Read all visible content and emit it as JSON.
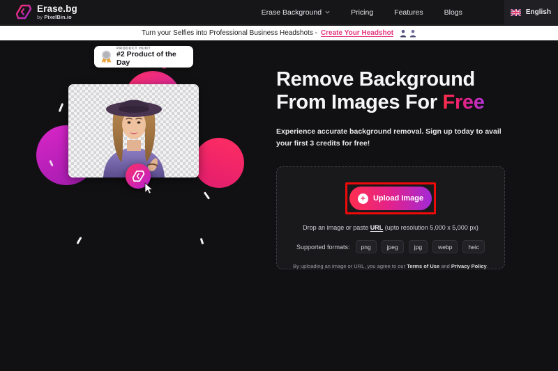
{
  "brand": {
    "name": "Erase.bg",
    "by_prefix": "by ",
    "by_name": "PixelBin.io",
    "logo_icon": "erasebg-logo-icon"
  },
  "nav": {
    "items": [
      {
        "label": "Erase Background",
        "has_dropdown": true,
        "icon": "chevron-down-icon"
      },
      {
        "label": "Pricing",
        "has_dropdown": false
      },
      {
        "label": "Features",
        "has_dropdown": false
      },
      {
        "label": "Blogs",
        "has_dropdown": false
      }
    ],
    "language": {
      "label": "English",
      "flag_icon": "uk-flag-icon"
    }
  },
  "banner": {
    "text": "Turn your Selfies into Professional Business Headshots - ",
    "link": "Create Your Headshot",
    "icons": [
      "person-avatar-icon",
      "person-avatar-icon"
    ]
  },
  "hero": {
    "product_hunt": {
      "kicker": "PRODUCT HUNT",
      "title": "#2 Product of the Day",
      "icon": "medal-icon"
    },
    "image_alt": "woman-in-hat-cutout",
    "cursor_icon": "erasebg-mark-icon",
    "pointer_icon": "mouse-pointer-icon"
  },
  "content": {
    "headline_line1": "Remove Background",
    "headline_line2_prefix": "From Images For ",
    "headline_highlight": "Free",
    "subhead": "Experience accurate background removal. Sign up today to avail your first 3 credits for free!"
  },
  "upload": {
    "button_label": "Upload Image",
    "button_icon": "plus-icon",
    "highlight_color": "#ef0a0a",
    "drop_prefix": "Drop an image or paste ",
    "drop_url": "URL",
    "drop_suffix": " (upto resolution 5,000 x 5,000 px)",
    "formats_label": "Supported formats:",
    "formats": [
      "png",
      "jpeg",
      "jpg",
      "webp",
      "heic"
    ],
    "legal_prefix": "By uploading an image or URL, you agree to our ",
    "legal_terms": "Terms of Use",
    "legal_and": " and ",
    "legal_privacy": "Privacy Policy",
    "legal_suffix": "."
  },
  "colors": {
    "page_bg": "#111113",
    "nav_bg": "#161618",
    "banner_bg": "#ffffff",
    "accent_pink": "#e6357f",
    "accent_red": "#ff2e4f",
    "accent_purple": "#a22ad6"
  }
}
